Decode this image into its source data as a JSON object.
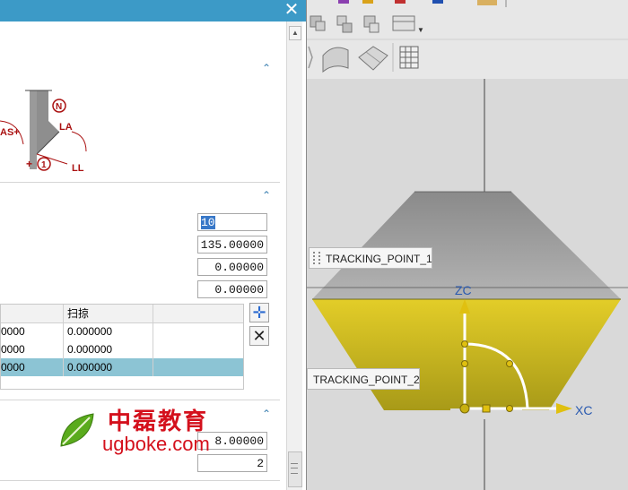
{
  "dialog": {
    "diagram_labels": {
      "n": "N",
      "la": "LA",
      "as_plus": "AS+",
      "ll": "LL",
      "plus_one": "+",
      "one": "1"
    },
    "fields": [
      "10",
      "135.00000",
      "0.00000",
      "0.00000"
    ],
    "table": {
      "headers": [
        "",
        "扫掠",
        ""
      ],
      "rows": [
        [
          "0000",
          "0.000000",
          ""
        ],
        [
          "0000",
          "0.000000",
          ""
        ],
        [
          "0000",
          "0.000000",
          ""
        ]
      ]
    },
    "bottom_fields": [
      "8.00000",
      "2"
    ],
    "watermark_cn": "中磊教育",
    "watermark_url": "ugboke.com"
  },
  "viewport": {
    "tracking_point_1": "TRACKING_POINT_1",
    "tracking_point_2": "TRACKING_POINT_2",
    "zc_label": "ZC",
    "xc_label": "XC"
  },
  "colors": {
    "titlebar": "#3c9ac7",
    "selection": "#8cc4d4",
    "watermark": "#d4101c",
    "cone_top": "#9a9a9a",
    "cone_bottom": "#d9c520"
  }
}
